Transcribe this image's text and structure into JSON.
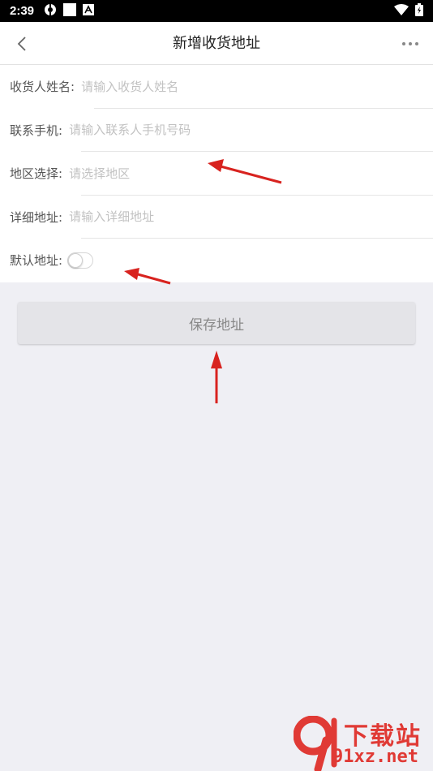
{
  "status_bar": {
    "time": "2:39"
  },
  "nav": {
    "title": "新增收货地址"
  },
  "form": {
    "receiver_name": {
      "label": "收货人姓名:",
      "placeholder": "请输入收货人姓名"
    },
    "phone": {
      "label": "联系手机:",
      "placeholder": "请输入联系人手机号码"
    },
    "region": {
      "label": "地区选择:",
      "placeholder": "请选择地区"
    },
    "detail_address": {
      "label": "详细地址:",
      "placeholder": "请输入详细地址"
    },
    "default_address": {
      "label": "默认地址:",
      "enabled": false
    }
  },
  "save_button": {
    "label": "保存地址"
  },
  "watermark": {
    "brand": "下载站",
    "domain": "91xz.net"
  },
  "colors": {
    "annotation_arrow": "#d8231f",
    "watermark": "#e03a35",
    "page_bg": "#efeff4"
  }
}
